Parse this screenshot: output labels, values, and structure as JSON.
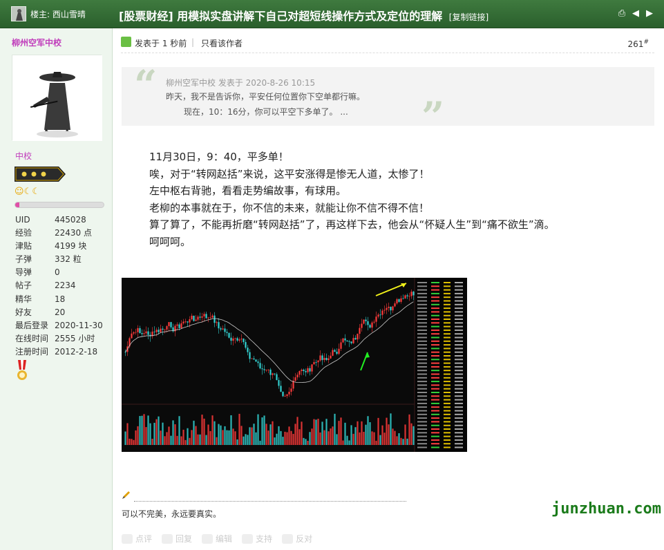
{
  "header": {
    "poster_label": "楼主: 西山雪晴",
    "title": "[股票财经] 用模拟实盘讲解下自己对超短线操作方式及定位的理解",
    "copy_link": "[复制链接]"
  },
  "sidebar": {
    "username": "柳州空军中校",
    "rank": "中校",
    "level_percent": 5,
    "stats": [
      {
        "key": "UID",
        "value": "445028"
      },
      {
        "key": "经验",
        "value": "22430 点"
      },
      {
        "key": "津贴",
        "value": "4199 块"
      },
      {
        "key": "子弹",
        "value": "332 粒"
      },
      {
        "key": "导弹",
        "value": "0"
      },
      {
        "key": "帖子",
        "value": "2234"
      },
      {
        "key": "精华",
        "value": "18"
      },
      {
        "key": "好友",
        "value": "20"
      },
      {
        "key": "最后登录",
        "value": "2020-11-30"
      },
      {
        "key": "在线时间",
        "value": "2555 小时"
      },
      {
        "key": "注册时间",
        "value": "2012-2-18"
      }
    ]
  },
  "post": {
    "posted": "发表于 1 秒前",
    "separator": "|",
    "only_author": "只看该作者",
    "floor": "261",
    "floor_mark": "#",
    "quote": {
      "header": "柳州空军中校 发表于 2020-8-26 10:15",
      "line1": "昨天，我不是告诉你，平安任何位置你下空单都行嘛。",
      "line2": "现在，10：16分，你可以平空下多单了。 ..."
    },
    "body": [
      "11月30日，9：40，平多单！",
      "唉，对于“转网赵括”来说，这平安涨得是惨无人道，太惨了！",
      "左中枢右背驰，看看走势编故事，有球用。",
      "老柳的本事就在于，你不信的未来，就能让你不信不得不信！",
      "算了算了，不能再折磨“转网赵括”了，再这样下去，他会从“怀疑人生”到“痛不欲生”滴。",
      "呵呵呵。"
    ],
    "signature": "可以不完美，永远要真实。"
  },
  "actions": [
    {
      "label": "点评",
      "icon": "comment-icon"
    },
    {
      "label": "回复",
      "icon": "reply-icon"
    },
    {
      "label": "编辑",
      "icon": "edit-icon"
    },
    {
      "label": "支持",
      "icon": "thumb-up-icon"
    },
    {
      "label": "反对",
      "icon": "thumb-down-icon"
    }
  ],
  "watermark": "junzhuan.com",
  "colors": {
    "header_green": "#2f6a30",
    "username_pink": "#c03dbb",
    "sidebar_bg": "#eef6ee"
  }
}
